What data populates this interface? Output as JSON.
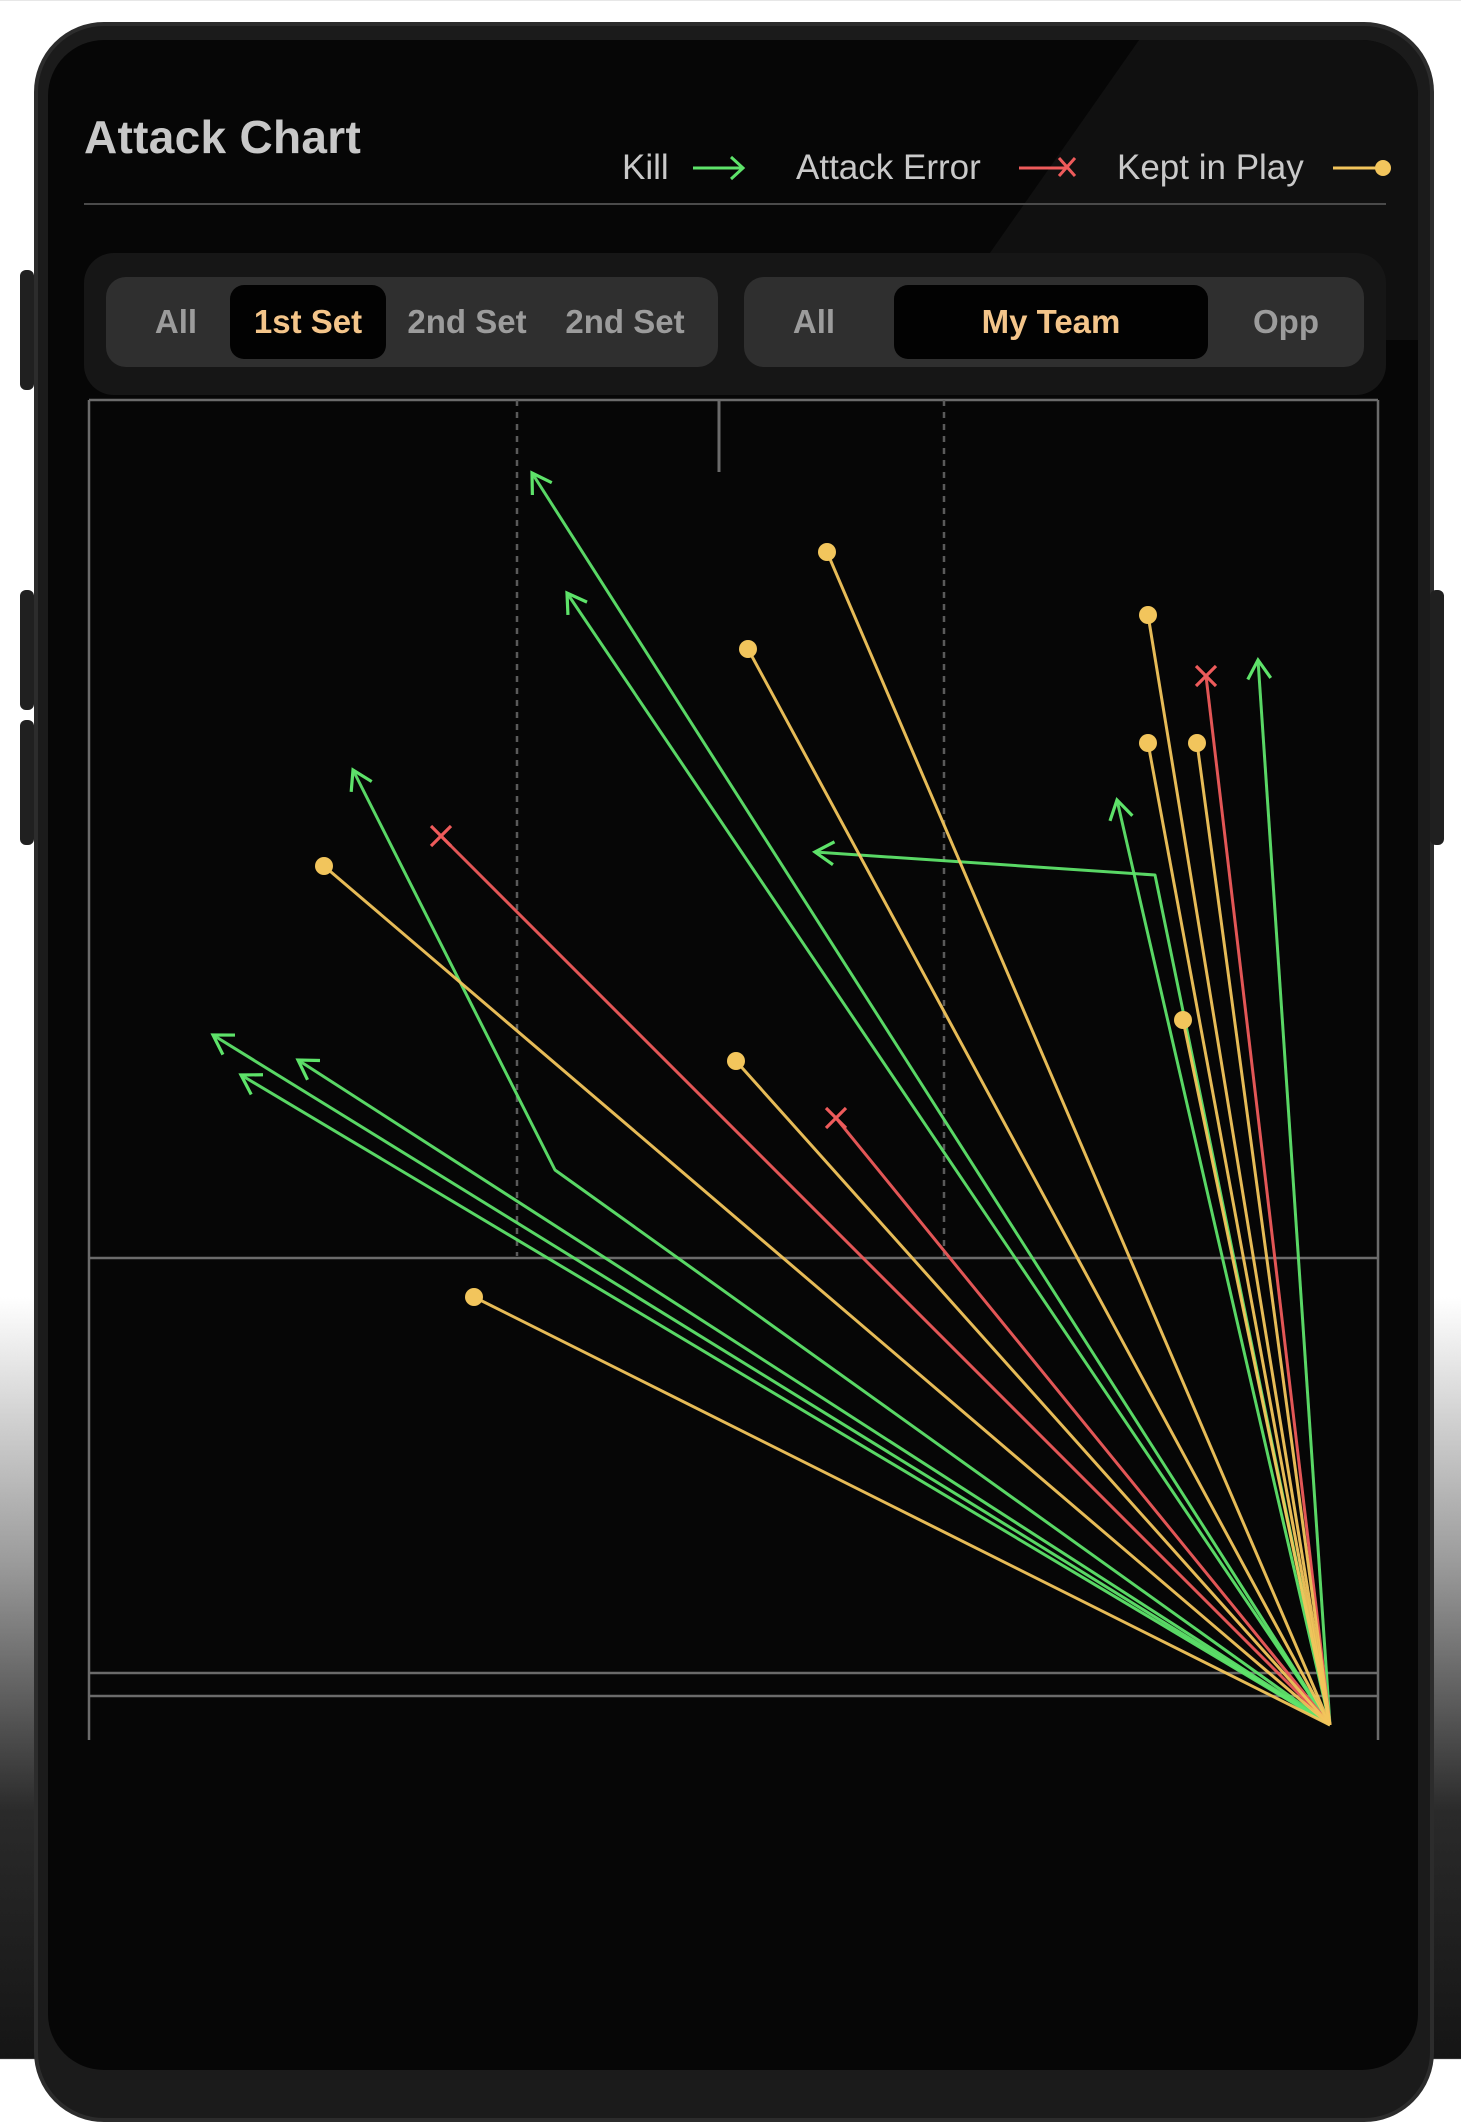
{
  "colors": {
    "kill": "#5ee36a",
    "error": "#ee5b5b",
    "kept": "#f2c55c",
    "court_line": "#6b6b6b",
    "active_text": "#f4c58a"
  },
  "header": {
    "title": "Attack Chart",
    "legend": [
      {
        "label": "Kill",
        "type": "kill",
        "icon": "arrow-icon"
      },
      {
        "label": "Attack Error",
        "type": "error",
        "icon": "x-icon"
      },
      {
        "label": "Kept in Play",
        "type": "kept",
        "icon": "dot-icon"
      }
    ]
  },
  "filters": {
    "sets": {
      "options": [
        "All",
        "1st Set",
        "2nd Set",
        "2nd Set"
      ],
      "selected": "1st Set"
    },
    "teams": {
      "options": [
        "All",
        "My Team",
        "Opp"
      ],
      "selected": "My Team"
    }
  },
  "chart_data": {
    "type": "scatter",
    "title": "Attack Chart",
    "origin": "right back corner",
    "attacks": [
      {
        "result": "kill"
      },
      {
        "result": "kill"
      },
      {
        "result": "kill"
      },
      {
        "result": "kill"
      },
      {
        "result": "kill"
      },
      {
        "result": "kill"
      },
      {
        "result": "kill"
      },
      {
        "result": "kill"
      },
      {
        "result": "kill"
      },
      {
        "result": "error"
      },
      {
        "result": "error"
      },
      {
        "result": "error"
      },
      {
        "result": "kept"
      },
      {
        "result": "kept"
      },
      {
        "result": "kept"
      },
      {
        "result": "kept"
      },
      {
        "result": "kept"
      },
      {
        "result": "kept"
      },
      {
        "result": "kept"
      },
      {
        "result": "kept"
      },
      {
        "result": "kept"
      }
    ]
  }
}
